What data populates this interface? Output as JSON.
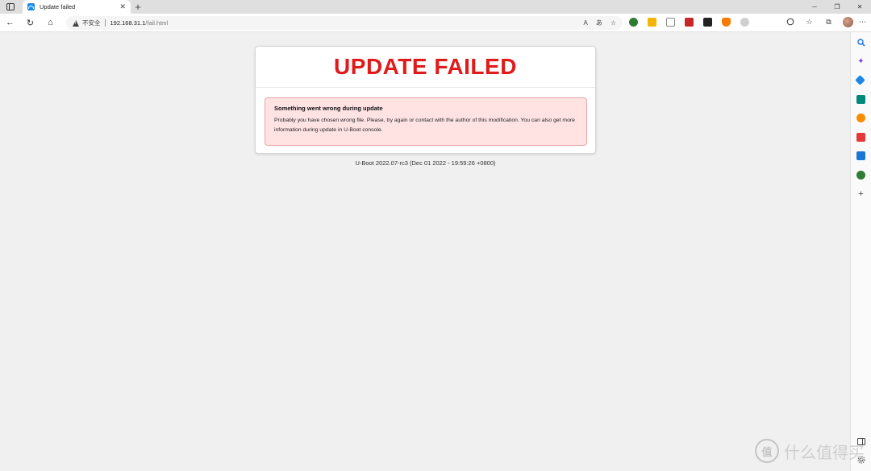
{
  "tab": {
    "title": "Update failed",
    "close": "✕",
    "new_tab": "+"
  },
  "window_controls": {
    "minimize": "─",
    "restore": "❐",
    "close": "✕"
  },
  "nav": {
    "back": "←",
    "reload": "↻",
    "home": "⌂"
  },
  "address": {
    "security_label": "不安全",
    "url_host": "192.168.31.1",
    "url_path": "/fail.html"
  },
  "addr_icons": {
    "read_aloud": "A",
    "translate": "あ",
    "favorite": "☆"
  },
  "right_tools": {
    "favorites": "☆",
    "collections": "⧉",
    "more": "⋯"
  },
  "page": {
    "title": "UPDATE FAILED",
    "alert_heading": "Something went wrong during update",
    "alert_body": "Probably you have chosen wrong file. Please, try again or contact with the author of this modification. You can also get more information during update in U-Boot console.",
    "footer": "U-Boot 2022.07-rc3 (Dec 01 2022 - 19:59:26 +0800)"
  },
  "sidebar": {
    "add": "+"
  },
  "watermark": {
    "logo": "值",
    "text": "什么值得买"
  },
  "colors": {
    "title_red": "#e01b1b",
    "alert_bg": "#ffe3e3",
    "alert_border": "#e8a3a3",
    "page_bg": "#f0f0f0"
  }
}
